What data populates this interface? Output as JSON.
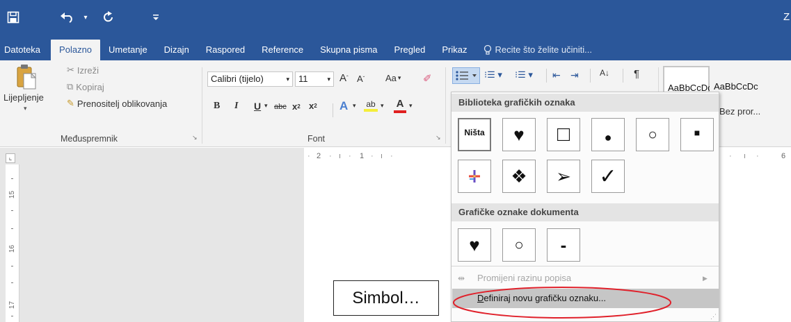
{
  "titlebar": {
    "corner_letter": "Z"
  },
  "tabs": [
    "Datoteka",
    "Polazno",
    "Umetanje",
    "Dizajn",
    "Raspored",
    "Reference",
    "Skupna pisma",
    "Pregled",
    "Prikaz"
  ],
  "tell_me": "Recite što želite učiniti...",
  "clipboard": {
    "paste": "Lijepljenje",
    "cut": "Izreži",
    "copy": "Kopiraj",
    "format_painter": "Prenositelj oblikovanja",
    "group": "Međuspremnik"
  },
  "font": {
    "name": "Calibri (tijelo)",
    "size": "11",
    "group": "Font",
    "case_label": "Aa"
  },
  "styles": {
    "style1": "AaBbCcDc",
    "style2": "AaBbCcDc",
    "style2_name": "Bez pror..."
  },
  "ruler": {
    "h_labels": [
      "2",
      "1",
      "6"
    ],
    "v_labels": [
      "15",
      "16",
      "17"
    ]
  },
  "bullet_menu": {
    "library_title": "Biblioteka grafičkih oznaka",
    "none_label": "Ništa",
    "library_bullets": [
      "♥",
      "□",
      "●",
      "○",
      "■",
      "colored-plus",
      "❖",
      "➢",
      "✓"
    ],
    "doc_title": "Grafičke oznake dokumenta",
    "doc_bullets": [
      "♥",
      "○",
      "-"
    ],
    "change_level": "Promijeni razinu popisa",
    "define_new": "Definiraj novu grafičku oznaku..."
  },
  "callout": {
    "text": "Simbol…"
  },
  "colors": {
    "accent": "#2b579a",
    "highlight_ellipse": "#e0202a"
  }
}
